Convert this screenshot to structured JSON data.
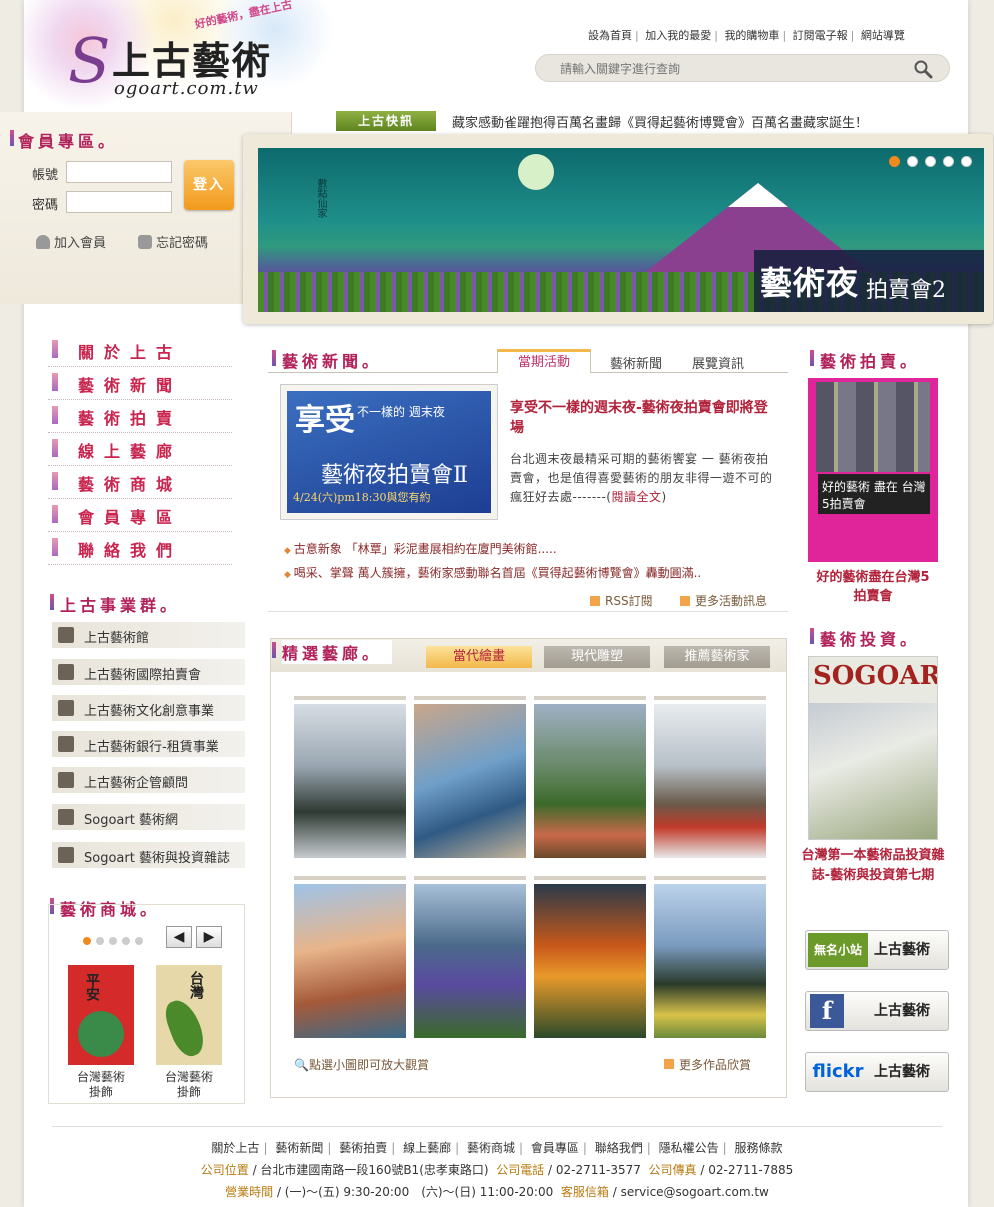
{
  "header": {
    "slogan": "好的藝術，盡在上古",
    "logo_s": "S",
    "logo_text": "上古藝術",
    "logo_domain": "ogoart.com.tw",
    "top_links": [
      "設為首頁",
      "加入我的最愛",
      "我的購物車",
      "訂閱電子報",
      "網站導覽"
    ],
    "search_placeholder": "請輸入關鍵字進行查詢",
    "news_flash_label": "上古快訊",
    "news_flash_text": "藏家感動雀躍抱得百萬名畫歸《買得起藝術博覽會》百萬名畫藏家誕生！"
  },
  "member": {
    "title": "會員專區。",
    "account_label": "帳號",
    "password_label": "密碼",
    "login_button": "登入",
    "join_link": "加入會員",
    "forgot_link": "忘記密碼"
  },
  "banner": {
    "caption_big": "藝術夜",
    "caption_small": "拍賣會2",
    "calligraphy": "數點仙家",
    "slides_total": 5,
    "active_slide": 1
  },
  "nav": {
    "items": [
      "關於上古",
      "藝術新聞",
      "藝術拍賣",
      "線上藝廊",
      "藝術商城",
      "會員專區",
      "聯絡我們"
    ]
  },
  "business": {
    "title": "上古事業群。",
    "items": [
      "上古藝術館",
      "上古藝術國際拍賣會",
      "上古藝術文化創意事業",
      "上古藝術銀行-租賃事業",
      "上古藝術企管顧問",
      "Sogoart 藝術網",
      "Sogoart 藝術與投資雜誌"
    ]
  },
  "shop": {
    "title": "藝術商城。",
    "prev": "◀",
    "next": "▶",
    "products": [
      {
        "name": "台灣藝術\n掛飾",
        "img_text": "平安"
      },
      {
        "name": "台灣藝術\n掛飾",
        "img_text": "台灣"
      }
    ]
  },
  "news": {
    "title": "藝術新聞。",
    "tabs": [
      "當期活動",
      "藝術新聞",
      "展覽資訊"
    ],
    "feature_img": {
      "t1": "享受",
      "t2": "不一樣的 週末夜",
      "t3": "藝術夜拍賣會Ⅱ",
      "t4": "4/24(六)pm18:30與您有約"
    },
    "feature_title": "享受不一樣的週末夜-藝術夜拍賣會即將登場",
    "feature_desc": "台北週末夜最精采可期的藝術饗宴 一 藝術夜拍賣會，也是值得喜愛藝術的朋友非得一遊不可的瘋狂好去處-------(",
    "read_more": "閱讀全文",
    "desc_end": ")",
    "list": [
      "古意新象 「林覃」彩泥畫展相約在廈門美術館.....",
      "喝采、掌聲 萬人簇擁，藝術家感動聯名首屆《買得起藝術博覽會》轟動圓滿.."
    ],
    "rss": "RSS訂閱",
    "more": "更多活動訊息"
  },
  "gallery": {
    "title": "精選藝廊。",
    "tabs": [
      "當代繪畫",
      "現代雕塑",
      "推薦藝術家"
    ],
    "hint": "點選小圖即可放大觀賞",
    "more": "更多作品欣賞"
  },
  "auction": {
    "title": "藝術拍賣。",
    "img_text": "好的藝術 盡在 台灣5拍賣會",
    "caption": "好的藝術盡在台灣5 拍賣會"
  },
  "invest": {
    "title": "藝術投資。",
    "mag_title": "SOGOART",
    "caption": "台灣第一本藝術品投資雜誌-藝術與投資第七期"
  },
  "social": [
    {
      "badge": "無名小站",
      "label": "上古藝術",
      "color": "#6c9a2a"
    },
    {
      "badge": "f",
      "label": "上古藝術",
      "color": "#3b5998"
    },
    {
      "badge": "flickr",
      "label": "上古藝術",
      "color": "#ffffff"
    }
  ],
  "footer": {
    "nav": [
      "關於上古",
      "藝術新聞",
      "藝術拍賣",
      "線上藝廊",
      "藝術商城",
      "會員專區",
      "聯絡我們",
      "隱私權公告",
      "服務條款"
    ],
    "addr_label": "公司位置",
    "addr": "台北市建國南路一段160號B1(忠孝東路口)",
    "tel_label": "公司電話",
    "tel": "02-2711-3577",
    "fax_label": "公司傳真",
    "fax": "02-2711-7885",
    "hours_label": "營業時間",
    "hours": "(一)～(五) 9:30-20:00　(六)～(日) 11:00-20:00",
    "mail_label": "客服信箱",
    "mail": "service@sogoart.com.tw"
  }
}
